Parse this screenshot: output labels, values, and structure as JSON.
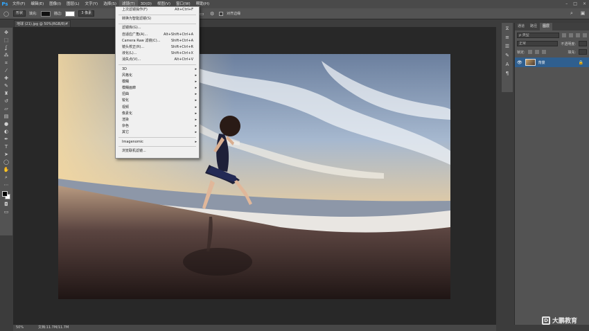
{
  "menubar": {
    "logo": "Ps",
    "items": [
      "文件(F)",
      "编辑(E)",
      "图像(I)",
      "图层(L)",
      "文字(Y)",
      "选择(S)",
      "滤镜(T)",
      "3D(D)",
      "视图(V)",
      "窗口(W)",
      "帮助(H)"
    ],
    "active_index": 6,
    "window_controls": [
      "–",
      "□",
      "×"
    ]
  },
  "optbar": {
    "shape_mode": "形状",
    "fill_label": "填充:",
    "stroke_label": "描边:",
    "stroke_width": "3 像素",
    "align_edges_label": "对齐边缘"
  },
  "document": {
    "tab_title": "地球 (21).jpg @ 50%(RGB/8) *",
    "close": "×",
    "zoom": "50%",
    "doc_size": "文档:11.7M/11.7M"
  },
  "filter_menu": [
    {
      "label": "上次滤镜操作(F)",
      "shortcut": "Alt+Ctrl+F",
      "type": "item"
    },
    {
      "type": "sep"
    },
    {
      "label": "转换为智能滤镜(S)",
      "shortcut": "",
      "type": "item"
    },
    {
      "type": "sep"
    },
    {
      "label": "滤镜库(G)...",
      "shortcut": "",
      "type": "item"
    },
    {
      "label": "自适应广角(A)...",
      "shortcut": "Alt+Shift+Ctrl+A",
      "type": "item"
    },
    {
      "label": "Camera Raw 滤镜(C)...",
      "shortcut": "Shift+Ctrl+A",
      "type": "item"
    },
    {
      "label": "镜头校正(R)...",
      "shortcut": "Shift+Ctrl+R",
      "type": "item"
    },
    {
      "label": "液化(L)...",
      "shortcut": "Shift+Ctrl+X",
      "type": "item"
    },
    {
      "label": "消失点(V)...",
      "shortcut": "Alt+Ctrl+V",
      "type": "item"
    },
    {
      "type": "sep"
    },
    {
      "label": "3D",
      "type": "sub"
    },
    {
      "label": "风格化",
      "type": "sub"
    },
    {
      "label": "模糊",
      "type": "sub"
    },
    {
      "label": "模糊画廊",
      "type": "sub"
    },
    {
      "label": "扭曲",
      "type": "sub"
    },
    {
      "label": "锐化",
      "type": "sub"
    },
    {
      "label": "视频",
      "type": "sub"
    },
    {
      "label": "像素化",
      "type": "sub"
    },
    {
      "label": "渲染",
      "type": "sub"
    },
    {
      "label": "杂色",
      "type": "sub"
    },
    {
      "label": "其它",
      "type": "sub"
    },
    {
      "type": "sep"
    },
    {
      "label": "Imagenomic",
      "type": "sub"
    },
    {
      "type": "sep"
    },
    {
      "label": "浏览联机滤镜...",
      "shortcut": "",
      "type": "item"
    }
  ],
  "layers_panel": {
    "tabs": [
      "通道",
      "路径",
      "图层"
    ],
    "active_tab": 2,
    "kind_label": "ρ 类型",
    "blend_mode": "正常",
    "opacity_label": "不透明度:",
    "lock_label": "锁定:",
    "fill_label": "填充:",
    "layer_name": "背景"
  },
  "watermark": "大鹏教育"
}
